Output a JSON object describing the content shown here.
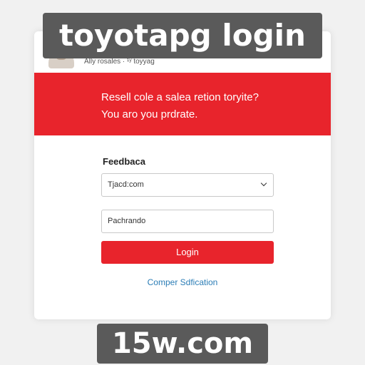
{
  "overlay": {
    "title": "toyotapg login",
    "domain": "15w.com"
  },
  "header": {
    "caption": "Ally rosales · ¹ʸ toyyag"
  },
  "banner": {
    "line1": "Resell cole a salea retion toryite?",
    "line2": "You aro you prdrate.",
    "color": "#e8242c"
  },
  "form": {
    "label": "Feedbaca",
    "select_value": "Tjacd:com",
    "input_value": "Pachrando",
    "login_label": "Login",
    "link_label": "Comper Sdfication"
  },
  "colors": {
    "accent": "#e8242c",
    "link": "#2b7db6"
  }
}
